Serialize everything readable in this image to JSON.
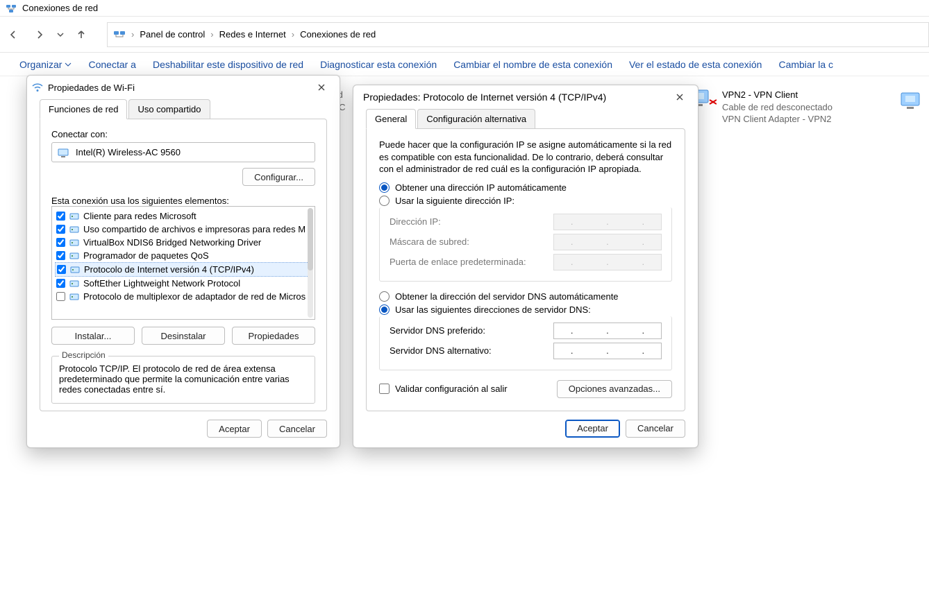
{
  "explorer": {
    "window_title": "Conexiones de red",
    "breadcrumb": [
      "Panel de control",
      "Redes e Internet",
      "Conexiones de red"
    ],
    "commands": {
      "organize": "Organizar",
      "connect": "Conectar a",
      "disable": "Deshabilitar este dispositivo de red",
      "diagnose": "Diagnosticar esta conexión",
      "rename": "Cambiar el nombre de esta conexión",
      "status": "Ver el estado de esta conexión",
      "change": "Cambiar la c"
    },
    "connections": {
      "vpn2": {
        "name": "VPN2 - VPN Client",
        "status": "Cable de red desconectado",
        "device": "VPN Client Adapter - VPN2"
      },
      "hidden1_hint": "Red",
      "hidden1_c": "de C"
    }
  },
  "wifi": {
    "title": "Propiedades de Wi-Fi",
    "tabs": {
      "net": "Funciones de red",
      "share": "Uso compartido"
    },
    "connect_with_label": "Conectar con:",
    "adapter": "Intel(R) Wireless-AC 9560",
    "configure": "Configurar...",
    "uses_label": "Esta conexión usa los siguientes elementos:",
    "components": [
      {
        "checked": true,
        "sel": false,
        "label": "Cliente para redes Microsoft"
      },
      {
        "checked": true,
        "sel": false,
        "label": "Uso compartido de archivos e impresoras para redes M"
      },
      {
        "checked": true,
        "sel": false,
        "label": "VirtualBox NDIS6 Bridged Networking Driver"
      },
      {
        "checked": true,
        "sel": false,
        "label": "Programador de paquetes QoS"
      },
      {
        "checked": true,
        "sel": true,
        "label": "Protocolo de Internet versión 4 (TCP/IPv4)"
      },
      {
        "checked": true,
        "sel": false,
        "label": "SoftEther Lightweight Network Protocol"
      },
      {
        "checked": false,
        "sel": false,
        "label": "Protocolo de multiplexor de adaptador de red de Micros"
      }
    ],
    "install": "Instalar...",
    "uninstall": "Desinstalar",
    "properties": "Propiedades",
    "desc_legend": "Descripción",
    "desc_text": "Protocolo TCP/IP. El protocolo de red de área extensa predeterminado que permite la comunicación entre varias redes conectadas entre sí.",
    "accept": "Aceptar",
    "cancel": "Cancelar"
  },
  "ipv4": {
    "title": "Propiedades: Protocolo de Internet versión 4 (TCP/IPv4)",
    "tabs": {
      "general": "General",
      "alt": "Configuración alternativa"
    },
    "intro": "Puede hacer que la configuración IP se asigne automáticamente si la red es compatible con esta funcionalidad. De lo contrario, deberá consultar con el administrador de red cuál es la configuración IP apropiada.",
    "ip_auto": "Obtener una dirección IP automáticamente",
    "ip_manual": "Usar la siguiente dirección IP:",
    "ip_addr": "Dirección IP:",
    "mask": "Máscara de subred:",
    "gateway": "Puerta de enlace predeterminada:",
    "dns_auto": "Obtener la dirección del servidor DNS automáticamente",
    "dns_manual": "Usar las siguientes direcciones de servidor DNS:",
    "dns_pref": "Servidor DNS preferido:",
    "dns_alt": "Servidor DNS alternativo:",
    "validate": "Validar configuración al salir",
    "advanced": "Opciones avanzadas...",
    "accept": "Aceptar",
    "cancel": "Cancelar",
    "ip_mode_selected": "auto",
    "dns_mode_selected": "manual",
    "values": {
      "ip": "",
      "mask": "",
      "gateway": "",
      "dns1": "",
      "dns2": ""
    }
  }
}
